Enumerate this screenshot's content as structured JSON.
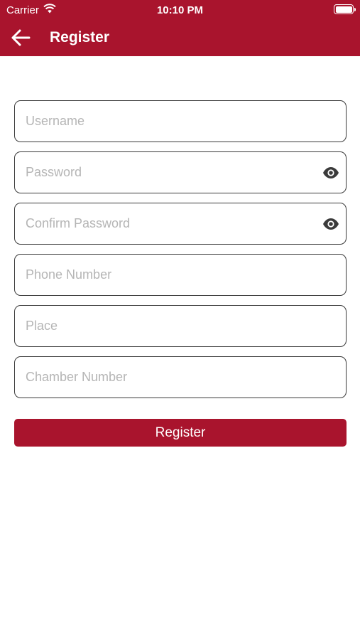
{
  "status_bar": {
    "carrier": "Carrier",
    "time": "10:10 PM"
  },
  "header": {
    "title": "Register"
  },
  "form": {
    "fields": [
      {
        "placeholder": "Username",
        "value": ""
      },
      {
        "placeholder": "Password",
        "value": ""
      },
      {
        "placeholder": "Confirm Password",
        "value": ""
      },
      {
        "placeholder": "Phone Number",
        "value": ""
      },
      {
        "placeholder": "Place",
        "value": ""
      },
      {
        "placeholder": "Chamber Number",
        "value": ""
      }
    ],
    "submit_label": "Register"
  },
  "colors": {
    "brand": "#a9142d",
    "border": "#3a3a3a",
    "placeholder": "#b5b5b5"
  },
  "icons": {
    "back": "arrow-left-icon",
    "visibility": "eye-icon",
    "wifi": "wifi-icon",
    "battery": "battery-icon"
  }
}
